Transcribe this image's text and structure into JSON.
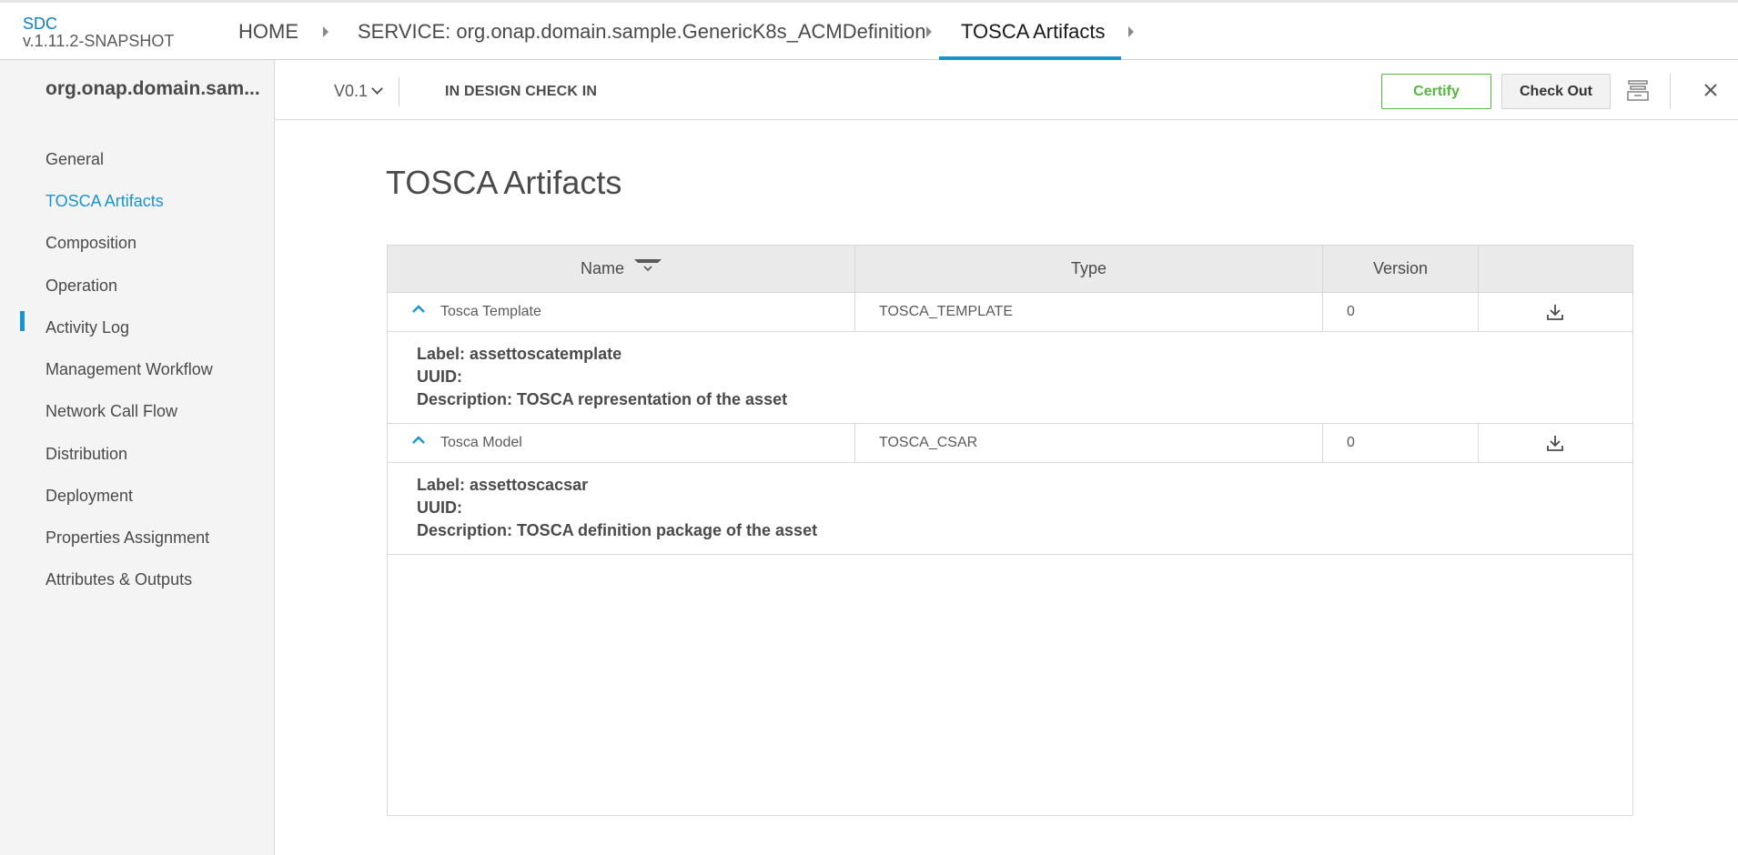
{
  "brand": {
    "name": "SDC",
    "version": "v.1.11.2-SNAPSHOT"
  },
  "breadcrumbs": [
    {
      "label": "HOME"
    },
    {
      "label": "SERVICE: org.onap.domain.sample.GenericK8s_ACMDefinition"
    },
    {
      "label": "TOSCA Artifacts"
    }
  ],
  "subheader": {
    "asset_name": "org.onap.domain.sam...",
    "version": "V0.1",
    "state": "IN DESIGN CHECK IN",
    "certify_label": "Certify",
    "checkout_label": "Check Out"
  },
  "sidebar": {
    "items": [
      {
        "label": "General"
      },
      {
        "label": "TOSCA Artifacts"
      },
      {
        "label": "Composition"
      },
      {
        "label": "Operation"
      },
      {
        "label": "Activity Log"
      },
      {
        "label": "Management Workflow"
      },
      {
        "label": "Network Call Flow"
      },
      {
        "label": "Distribution"
      },
      {
        "label": "Deployment"
      },
      {
        "label": "Properties Assignment"
      },
      {
        "label": "Attributes & Outputs"
      }
    ],
    "active_index": 1
  },
  "main": {
    "title": "TOSCA Artifacts",
    "table": {
      "headers": {
        "name": "Name",
        "type": "Type",
        "version": "Version"
      },
      "rows": [
        {
          "name": "Tosca Template",
          "type": "TOSCA_TEMPLATE",
          "version": "0",
          "label_line": "Label: assettoscatemplate",
          "uuid_line": "UUID:",
          "description_line": "Description: TOSCA representation of the asset"
        },
        {
          "name": "Tosca Model",
          "type": "TOSCA_CSAR",
          "version": "0",
          "label_line": "Label: assettoscacsar",
          "uuid_line": "UUID:",
          "description_line": "Description: TOSCA definition package of the asset"
        }
      ]
    }
  },
  "colors": {
    "accent": "#1a94cf",
    "certify": "#52b83f",
    "sidebar_bg": "#f4f4f4",
    "header_bg": "#eaeaea"
  },
  "icons": [
    "archive-icon",
    "close-icon",
    "sort-icon",
    "expand-icon",
    "download-icon"
  ]
}
